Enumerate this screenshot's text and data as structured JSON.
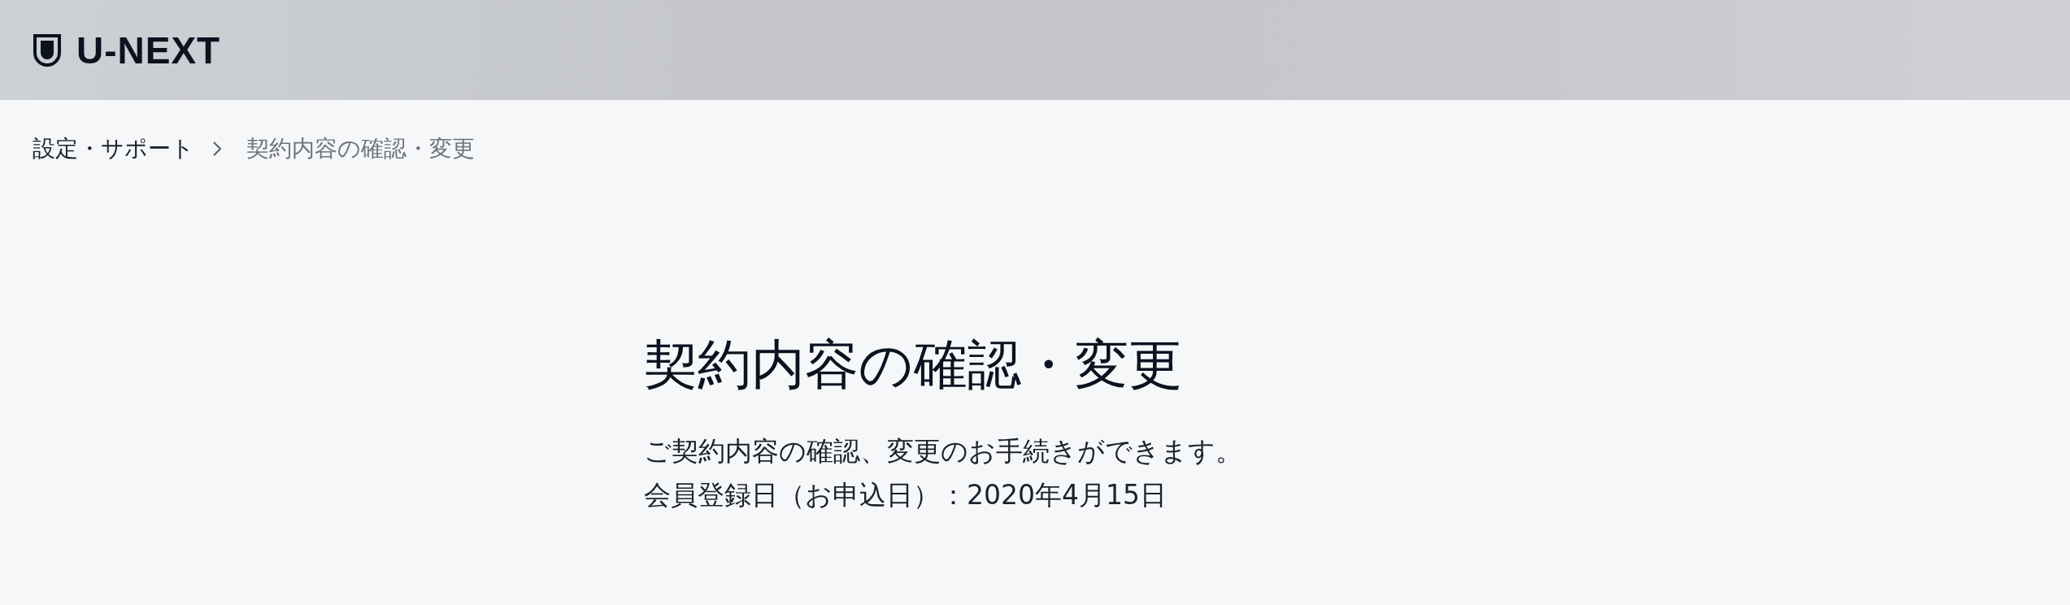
{
  "header": {
    "logo_text": "U-NEXT"
  },
  "breadcrumb": [
    {
      "label": "設定・サポート",
      "current": false
    },
    {
      "label": "契約内容の確認・変更",
      "current": true
    }
  ],
  "page": {
    "title": "契約内容の確認・変更",
    "description": "ご契約内容の確認、変更のお手続きができます。",
    "registration": "会員登録日（お申込日）：2020年4月15日"
  }
}
